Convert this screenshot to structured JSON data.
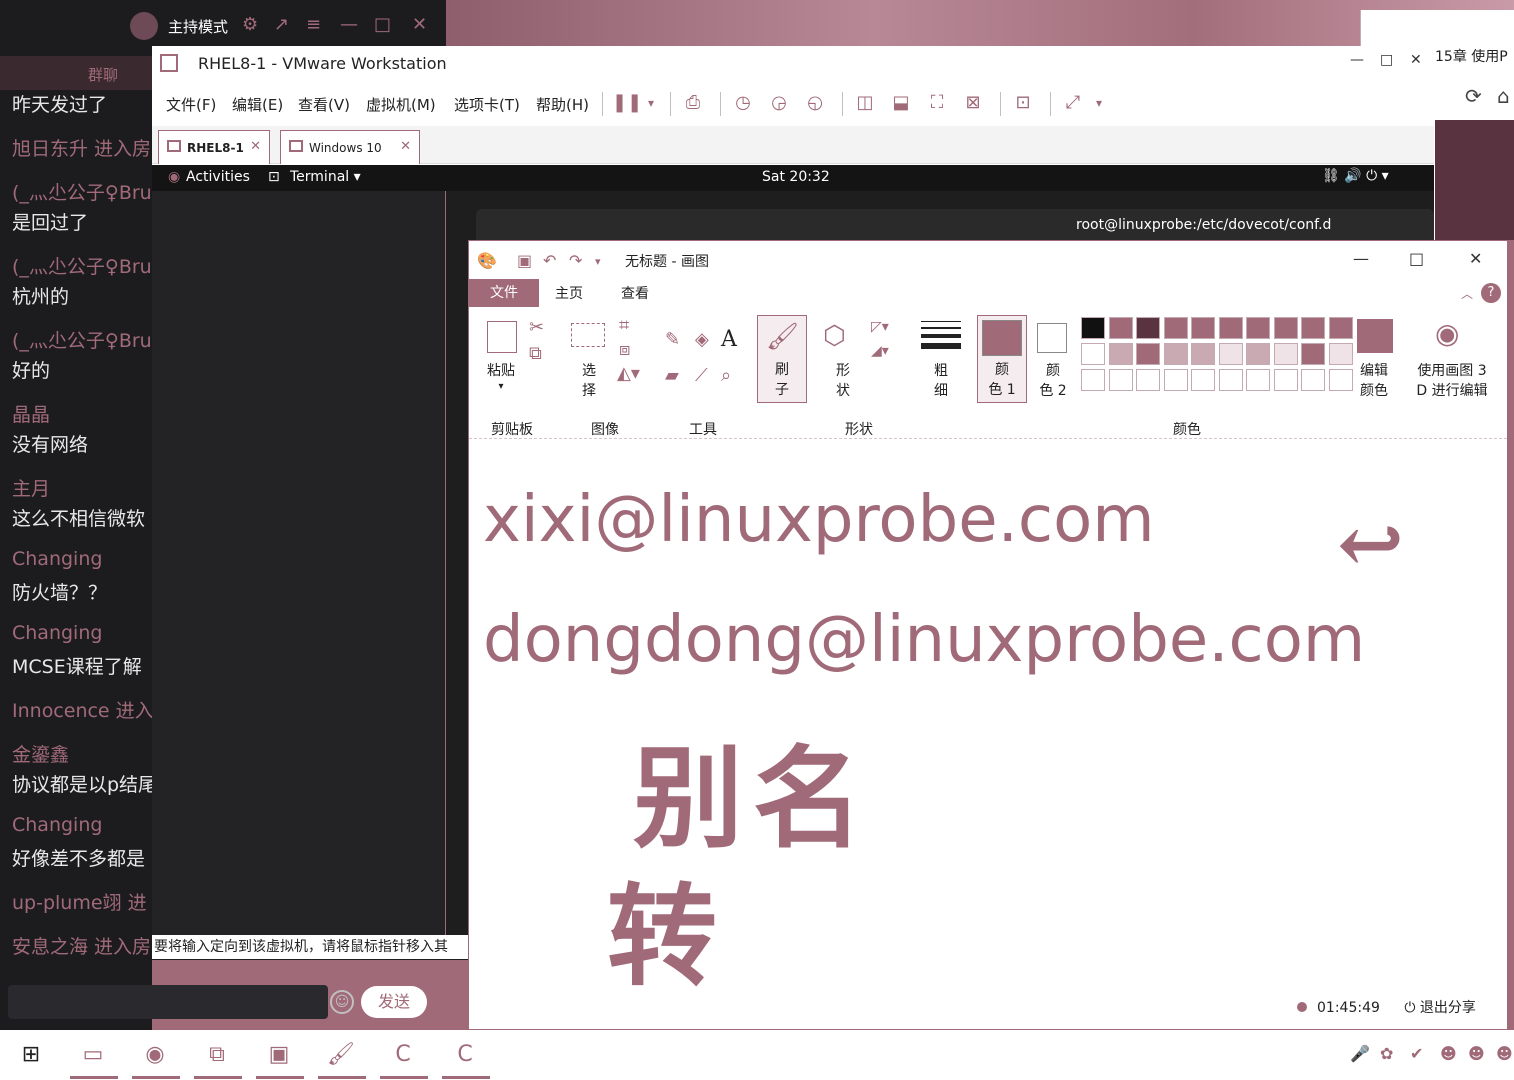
{
  "chat": {
    "host_mode": "主持模式",
    "tab": "群聊",
    "messages": [
      {
        "kind": "text",
        "text": "昨天发过了"
      },
      {
        "kind": "name",
        "text": "旭日东升 进入房"
      },
      {
        "kind": "name",
        "text": "(_灬尐公子♀Bru"
      },
      {
        "kind": "text",
        "text": "是回过了"
      },
      {
        "kind": "name",
        "text": "(_灬尐公子♀Bru"
      },
      {
        "kind": "text",
        "text": "杭州的"
      },
      {
        "kind": "name",
        "text": "(_灬尐公子♀Bru"
      },
      {
        "kind": "text",
        "text": "好的"
      },
      {
        "kind": "name",
        "text": "晶晶"
      },
      {
        "kind": "text",
        "text": "没有网络"
      },
      {
        "kind": "name",
        "text": "主月"
      },
      {
        "kind": "text",
        "text": "这么不相信微软"
      },
      {
        "kind": "name",
        "text": "Changing"
      },
      {
        "kind": "text",
        "text": "防火墙？？"
      },
      {
        "kind": "name",
        "text": "Changing"
      },
      {
        "kind": "text",
        "text": "MCSE课程了解"
      },
      {
        "kind": "name",
        "text": "Innocence 进入"
      },
      {
        "kind": "name",
        "text": "金鎏鑫"
      },
      {
        "kind": "text",
        "text": "协议都是以p结尾"
      },
      {
        "kind": "name",
        "text": "Changing"
      },
      {
        "kind": "text",
        "text": "好像差不多都是"
      },
      {
        "kind": "name",
        "text": "up-plume翊 进"
      },
      {
        "kind": "name",
        "text": "安息之海 进入房"
      }
    ],
    "send_label": "发送"
  },
  "desktop_right": {
    "chapter_text": "15章 使用P",
    "colors": {
      "accent": "#a06a78"
    }
  },
  "vmware": {
    "title": "RHEL8-1 - VMware Workstation",
    "menu": [
      "文件(F)",
      "编辑(E)",
      "查看(V)",
      "虚拟机(M)",
      "选项卡(T)",
      "帮助(H)"
    ],
    "tabs": [
      "RHEL8-1",
      "Windows 10"
    ],
    "status_text": "要将输入定向到该虚拟机，请将鼠标指针移入其"
  },
  "guest": {
    "activities": "Activities",
    "terminal": "Terminal ▾",
    "clock": "Sat 20:32",
    "terminal_title": "root@linuxprobe:/etc/dovecot/conf.d"
  },
  "paint": {
    "title": "无标题 - 画图",
    "tabs": {
      "file": "文件",
      "home": "主页",
      "view": "查看"
    },
    "ribbon": {
      "paste": "粘贴",
      "select": "选\n择",
      "brush": "刷\n子",
      "shapes": "形\n状",
      "size": "粗\n细",
      "color1": "颜\n色 1",
      "color2": "颜\n色 2",
      "edit_colors": "编辑\n颜色",
      "paint3d": "使用画图 3\nD 进行编辑",
      "groups": {
        "clipboard": "剪贴板",
        "image": "图像",
        "tools": "工具",
        "shapes": "形状",
        "colors": "颜色"
      }
    },
    "canvas": {
      "line1": "xixi@linuxprobe.com",
      "line2": "dongdong@linuxprobe.com",
      "hand1": "别名",
      "hand2": "转"
    },
    "share": {
      "timer": "01:45:49",
      "exit": "退出分享"
    }
  }
}
